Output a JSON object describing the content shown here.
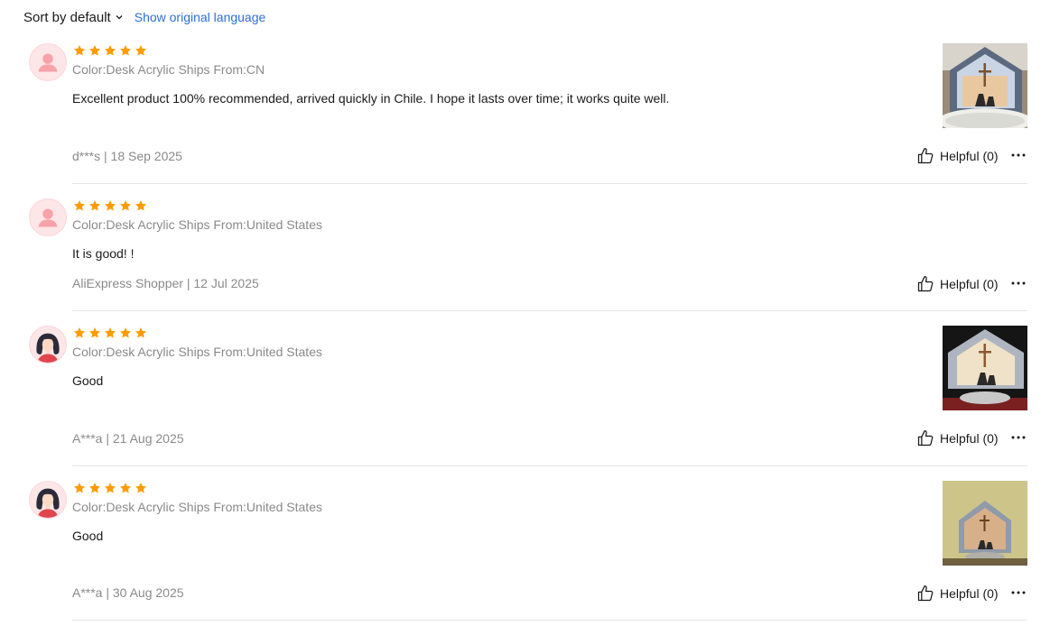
{
  "toolbar": {
    "sort_label": "Sort by default",
    "show_original_label": "Show original language"
  },
  "colors": {
    "star": "#ff9c00",
    "link": "#2e6fd8",
    "muted": "#8a8a8a"
  },
  "reviews": [
    {
      "rating": 5,
      "avatar": "default-person-icon",
      "meta": "Color:Desk Acrylic Ships From:CN",
      "text": "Excellent product 100% recommended, arrived quickly in Chile. I hope it lasts over time; it works quite well.",
      "byline": "d***s | 18 Sep 2025",
      "helpful": "Helpful (0)",
      "has_photo": true
    },
    {
      "rating": 5,
      "avatar": "default-person-icon",
      "meta": "Color:Desk Acrylic Ships From:United States",
      "text": "It is good! !",
      "byline": "AliExpress Shopper | 12 Jul 2025",
      "helpful": "Helpful (0)",
      "has_photo": false
    },
    {
      "rating": 5,
      "avatar": "female-avatar-icon",
      "meta": "Color:Desk Acrylic Ships From:United States",
      "text": "Good",
      "byline": "A***a | 21 Aug 2025",
      "helpful": "Helpful (0)",
      "has_photo": true
    },
    {
      "rating": 5,
      "avatar": "female-avatar-icon",
      "meta": "Color:Desk Acrylic Ships From:United States",
      "text": "Good",
      "byline": "A***a | 30 Aug 2025",
      "helpful": "Helpful (0)",
      "has_photo": true
    }
  ]
}
